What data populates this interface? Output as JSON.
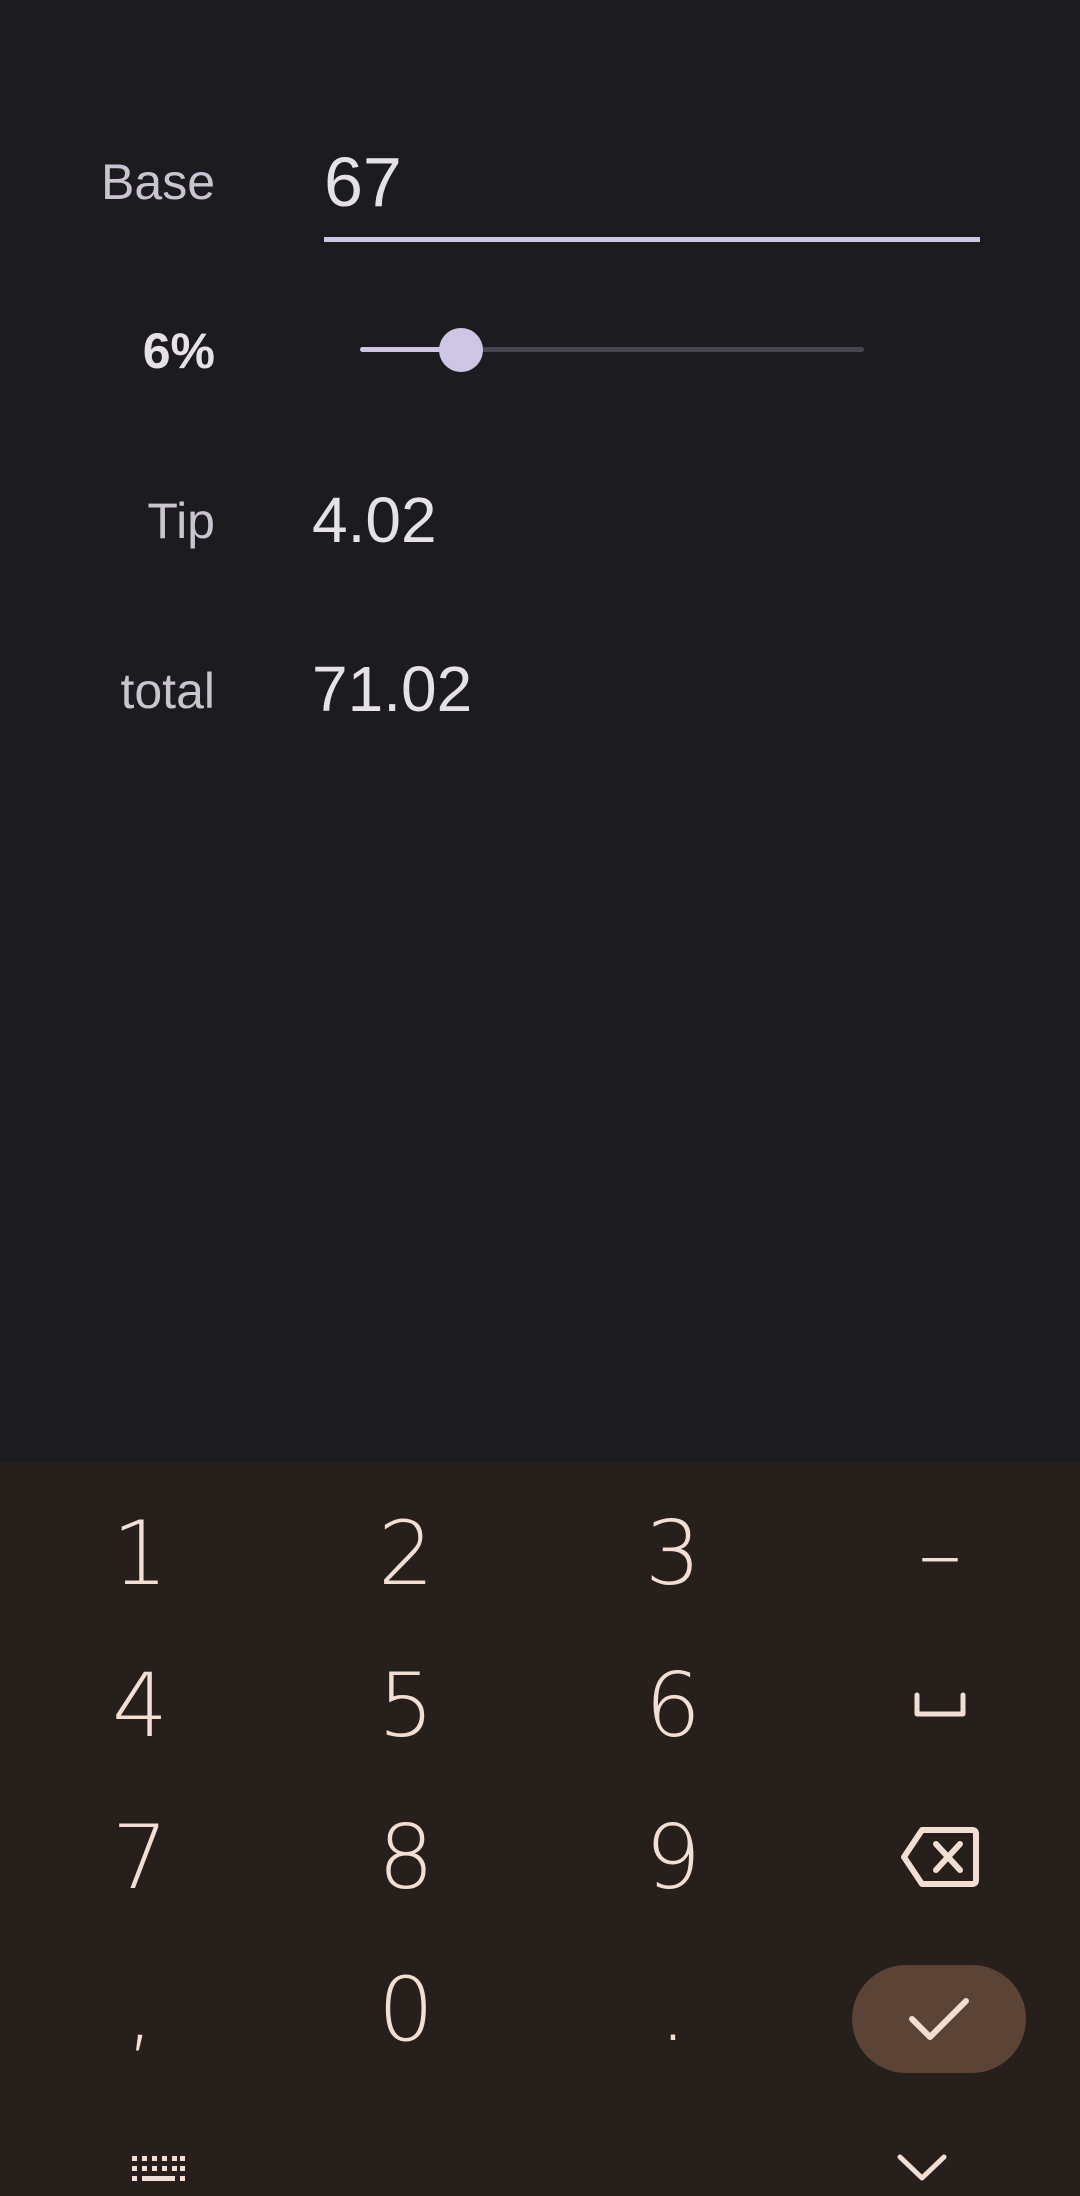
{
  "form": {
    "base_label": "Base",
    "base_value": "67",
    "percent_label": "6%",
    "percent_value": 0.06,
    "slider_fraction": 0.2,
    "tip_label": "Tip",
    "tip_value": "4.02",
    "total_label": "total",
    "total_value": "71.02"
  },
  "keyboard": {
    "rows": [
      [
        "1",
        "2",
        "3",
        "–"
      ],
      [
        "4",
        "5",
        "6",
        "space"
      ],
      [
        "7",
        "8",
        "9",
        "backspace"
      ],
      [
        ",",
        "0",
        ".",
        "enter"
      ]
    ],
    "icons": {
      "space": "space-bar-icon",
      "backspace": "backspace-icon",
      "enter": "check-icon",
      "switch_keyboard": "keyboard-icon",
      "hide_keyboard": "chevron-down-icon"
    }
  },
  "colors": {
    "background": "#1c1b1f",
    "accent": "#cfc6e6",
    "keyboard_bg": "#271f1b",
    "key_text": "#f3ded3",
    "enter_bg": "#5b4335"
  }
}
